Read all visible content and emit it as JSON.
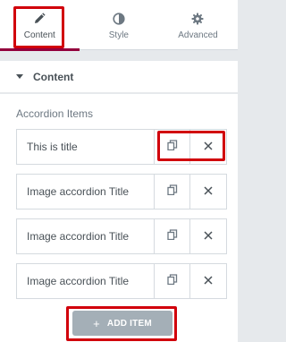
{
  "tabs": [
    {
      "label": "Content",
      "icon": "pencil-icon",
      "active": true
    },
    {
      "label": "Style",
      "icon": "half-circle-icon",
      "active": false
    },
    {
      "label": "Advanced",
      "icon": "gear-icon",
      "active": false
    }
  ],
  "section": {
    "title": "Content"
  },
  "repeater": {
    "label": "Accordion Items",
    "items": [
      {
        "title": "This is title"
      },
      {
        "title": "Image accordion Title"
      },
      {
        "title": "Image accordion Title"
      },
      {
        "title": "Image accordion Title"
      }
    ],
    "add_label": "ADD ITEM",
    "add_symbol": "+"
  },
  "colors": {
    "highlight": "#d1000b",
    "active_tab": "#93003c",
    "add_button": "#a4afb7"
  }
}
